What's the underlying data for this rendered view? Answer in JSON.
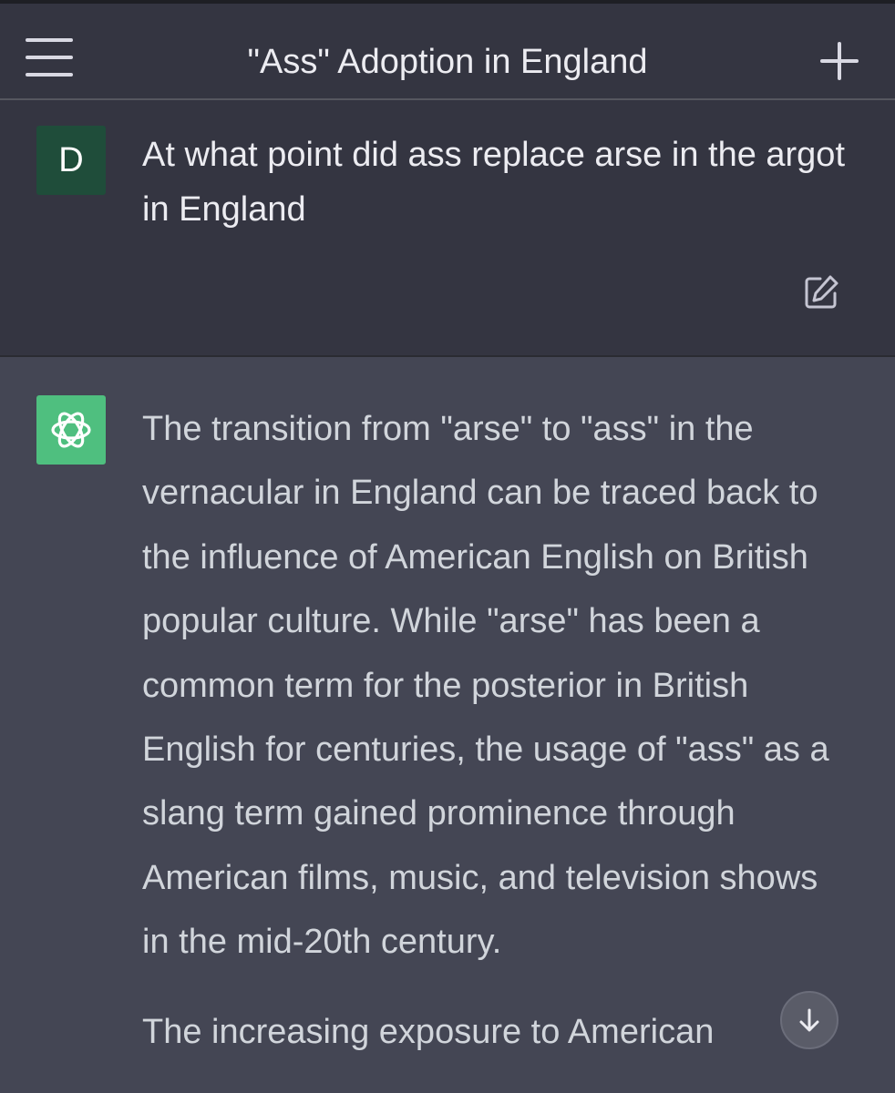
{
  "header": {
    "title": "\"Ass\" Adoption in England",
    "menu_icon": "hamburger-menu-icon",
    "new_chat_icon": "plus-icon"
  },
  "conversation": {
    "user": {
      "avatar_initial": "D",
      "avatar_color": "#1f4d3a",
      "message": "At what point did ass replace arse in the argot in England",
      "edit_icon": "edit-icon"
    },
    "assistant": {
      "avatar_icon": "openai-logo-icon",
      "avatar_color": "#4fbf7f",
      "paragraphs": [
        "The transition from \"arse\" to \"ass\" in the vernacular in England can be traced back to the influence of American English on British popular culture. While \"arse\" has been a common term for the posterior in British English for centuries, the usage of \"ass\" as a slang term gained prominence through American films, music, and television shows in the mid-20th century.",
        "The increasing exposure to American"
      ]
    }
  },
  "scroll_button": {
    "icon": "arrow-down-icon"
  }
}
